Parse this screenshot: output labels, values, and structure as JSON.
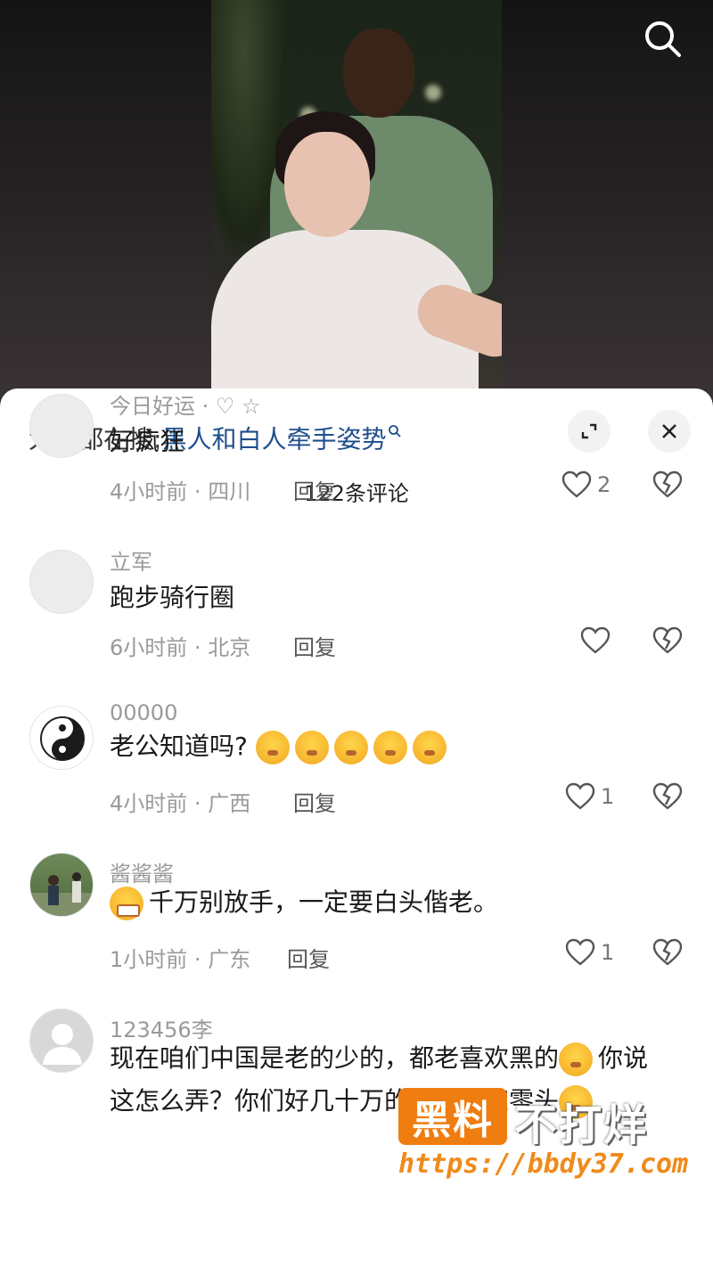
{
  "hot_search": {
    "prefix": "大家都在搜:",
    "term": "黑人和白人牵手姿势"
  },
  "comment_count": "122条评论",
  "comments": [
    {
      "username": "今日好运 · ♡ ☆",
      "content": "好疯狂",
      "time": "4小时前",
      "location": "四川",
      "reply": "回复",
      "likes": "2"
    },
    {
      "username": "立军",
      "content": "跑步骑行圈",
      "time": "6小时前",
      "location": "北京",
      "reply": "回复",
      "likes": ""
    },
    {
      "username": "00000",
      "content": "老公知道吗?",
      "time": "4小时前",
      "location": "广西",
      "reply": "回复",
      "likes": "1"
    },
    {
      "username": "酱酱酱",
      "content": "千万别放手，一定要白头偕老。",
      "time": "1小时前",
      "location": "广东",
      "reply": "回复",
      "likes": "1"
    },
    {
      "username": "123456李",
      "line1": "现在咱们中国是老的少的，都老喜欢黑的",
      "line1b": "你说",
      "line2": "这怎么弄？你们好几十万的不及人家零头"
    }
  ],
  "meta_separator": "·",
  "watermark": {
    "box": "黑料",
    "text": "不打烊",
    "url": "https://bbdy37.com"
  },
  "colors": {
    "link": "#1e4f8c",
    "watermark_orange": "#f07d10"
  }
}
